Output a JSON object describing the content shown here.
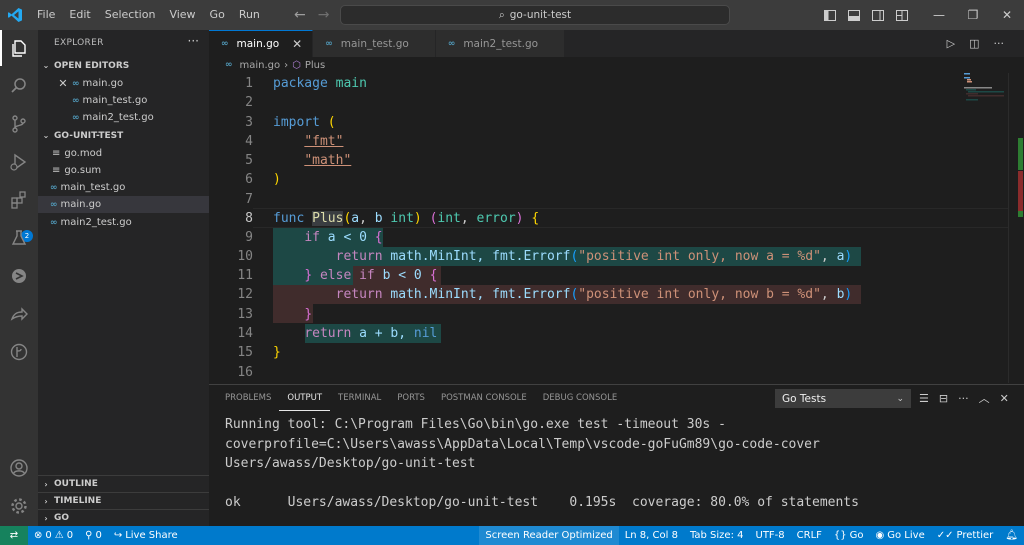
{
  "menu": [
    "File",
    "Edit",
    "Selection",
    "View",
    "Go",
    "Run"
  ],
  "command_center": {
    "text": "go-unit-test"
  },
  "sidebar": {
    "title": "EXPLORER",
    "open_editors_label": "OPEN EDITORS",
    "open_editors": [
      "main.go",
      "main_test.go",
      "main2_test.go"
    ],
    "project_label": "GO-UNIT-TEST",
    "files": [
      "go.mod",
      "go.sum",
      "main_test.go",
      "main.go",
      "main2_test.go"
    ],
    "outline_label": "OUTLINE",
    "timeline_label": "TIMELINE",
    "go_label": "GO",
    "extensions_badge": "2"
  },
  "tabs": [
    "main.go",
    "main_test.go",
    "main2_test.go"
  ],
  "breadcrumb": {
    "file": "main.go",
    "symbol": "Plus"
  },
  "code": {
    "line_numbers": [
      "1",
      "2",
      "3",
      "4",
      "5",
      "6",
      "7",
      "8",
      "9",
      "10",
      "11",
      "12",
      "13",
      "14",
      "15",
      "16"
    ],
    "package_kw": "package",
    "package_name": "main",
    "import_kw": "import",
    "open_paren": "(",
    "imp1": "\"fmt\"",
    "imp2": "\"math\"",
    "close_paren": ")",
    "func_kw": "func",
    "func_name": "Plus",
    "params_open": "(",
    "p_a": "a",
    ", ": ", ",
    "p_b": "b",
    "int": "int",
    "params_close": ")",
    "ret_open": "(",
    "ret_int": "int",
    "ret_err": "error",
    "ret_close": ")",
    "brace_open": "{",
    "if_kw": "if",
    "cond9": "a < 0",
    "cond11": "b < 0",
    "brace": "{",
    "return_kw": "return",
    "math_minint": "math.MinInt,",
    "fmt_errorf": "fmt.Errorf",
    "str10": "\"positive int only, now a = %d\"",
    "arg10": "a",
    "str12": "\"positive int only, now b = %d\"",
    "arg12": "b",
    "close_brace": "}",
    "else_kw": "else",
    "ret14_expr": "a + b,",
    "nil_kw": "nil"
  },
  "panel": {
    "tabs": [
      "PROBLEMS",
      "OUTPUT",
      "TERMINAL",
      "PORTS",
      "POSTMAN CONSOLE",
      "DEBUG CONSOLE"
    ],
    "active_tab": "OUTPUT",
    "channel": "Go Tests",
    "output_lines": [
      "Running tool: C:\\Program Files\\Go\\bin\\go.exe test -timeout 30s -",
      "coverprofile=C:\\Users\\awass\\AppData\\Local\\Temp\\vscode-goFuGm89\\go-code-cover",
      "Users/awass/Desktop/go-unit-test",
      "",
      "ok      Users/awass/Desktop/go-unit-test    0.195s  coverage: 80.0% of statements"
    ]
  },
  "status": {
    "errors": "0",
    "warnings": "0",
    "ports": "0",
    "live_share": "Live Share",
    "screen_reader": "Screen Reader Optimized",
    "position": "Ln 8, Col 8",
    "tab_size": "Tab Size: 4",
    "encoding": "UTF-8",
    "eol": "CRLF",
    "language": "Go",
    "go_live": "Go Live",
    "prettier": "Prettier"
  },
  "colors": {
    "accent": "#007acc",
    "coverage_covered": "#1d4845",
    "coverage_uncovered": "#402c2c"
  }
}
